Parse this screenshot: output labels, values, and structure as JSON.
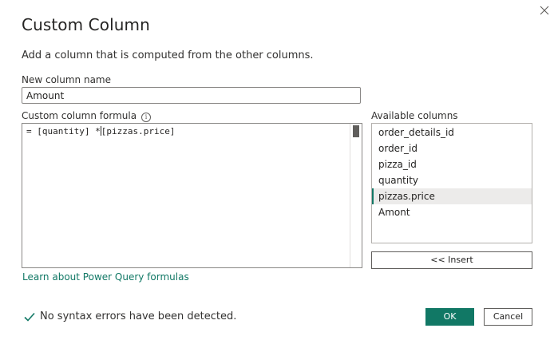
{
  "dialog": {
    "title": "Custom Column",
    "subtitle": "Add a column that is computed from the other columns."
  },
  "new_column": {
    "label": "New column name",
    "value": "Amount"
  },
  "formula": {
    "label": "Custom column formula",
    "info_icon": "i",
    "before_caret": "= [quantity] *",
    "after_caret": "[pizzas.price]"
  },
  "available_columns": {
    "label": "Available columns",
    "items": [
      "order_details_id",
      "order_id",
      "pizza_id",
      "quantity",
      "pizzas.price",
      "Amont"
    ],
    "selected": "pizzas.price"
  },
  "insert_button": "<< Insert",
  "learn_link": "Learn about Power Query formulas",
  "status": {
    "icon": "check-icon",
    "text": "No syntax errors have been detected."
  },
  "buttons": {
    "ok": "OK",
    "cancel": "Cancel"
  },
  "colors": {
    "accent": "#117865",
    "selected_bg": "#ecebea"
  }
}
